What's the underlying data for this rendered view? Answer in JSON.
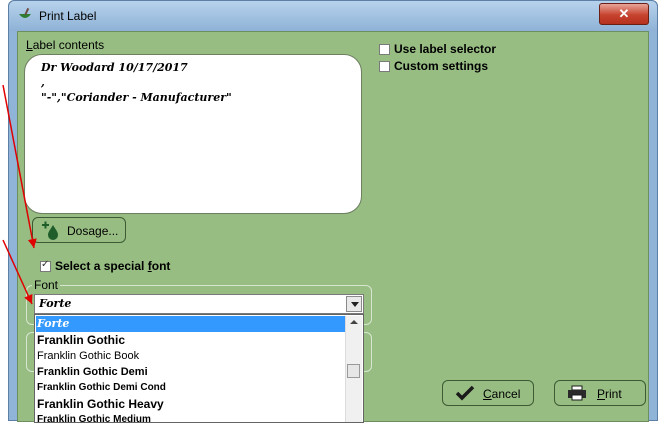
{
  "window": {
    "title": "Print Label",
    "close_glyph": "✕"
  },
  "label_contents": {
    "caption_first": "L",
    "caption_rest": "abel contents",
    "lines": [
      "Dr Woodard 10/17/2017",
      ",",
      "\"-\",\"Coriander - Manufacturer\""
    ]
  },
  "options": {
    "use_label_selector": {
      "label": "Use label selector",
      "checked": false
    },
    "custom_settings": {
      "label": "Custom settings",
      "checked": false
    }
  },
  "dosage_button": {
    "label": "Dosage...",
    "icon": "drop-add-icon"
  },
  "special_font": {
    "label_before": "Select a special ",
    "label_underlined": "f",
    "label_after": "ont",
    "checked": true
  },
  "font": {
    "group_caption": "Font",
    "selected": "Forte",
    "options": [
      "Forte",
      "Franklin Gothic",
      "Franklin Gothic Book",
      "Franklin Gothic Demi",
      "Franklin Gothic Demi Cond",
      "Franklin Gothic Heavy",
      "Franklin Gothic Medium"
    ]
  },
  "buttons": {
    "cancel": {
      "underlined": "C",
      "rest": "ancel",
      "icon": "checkmark-icon"
    },
    "print": {
      "underlined": "P",
      "rest": "rint",
      "icon": "printer-icon"
    }
  },
  "colors": {
    "client_background": "#97bd83",
    "selection": "#3399ff",
    "annotation_arrow": "#e00000"
  }
}
